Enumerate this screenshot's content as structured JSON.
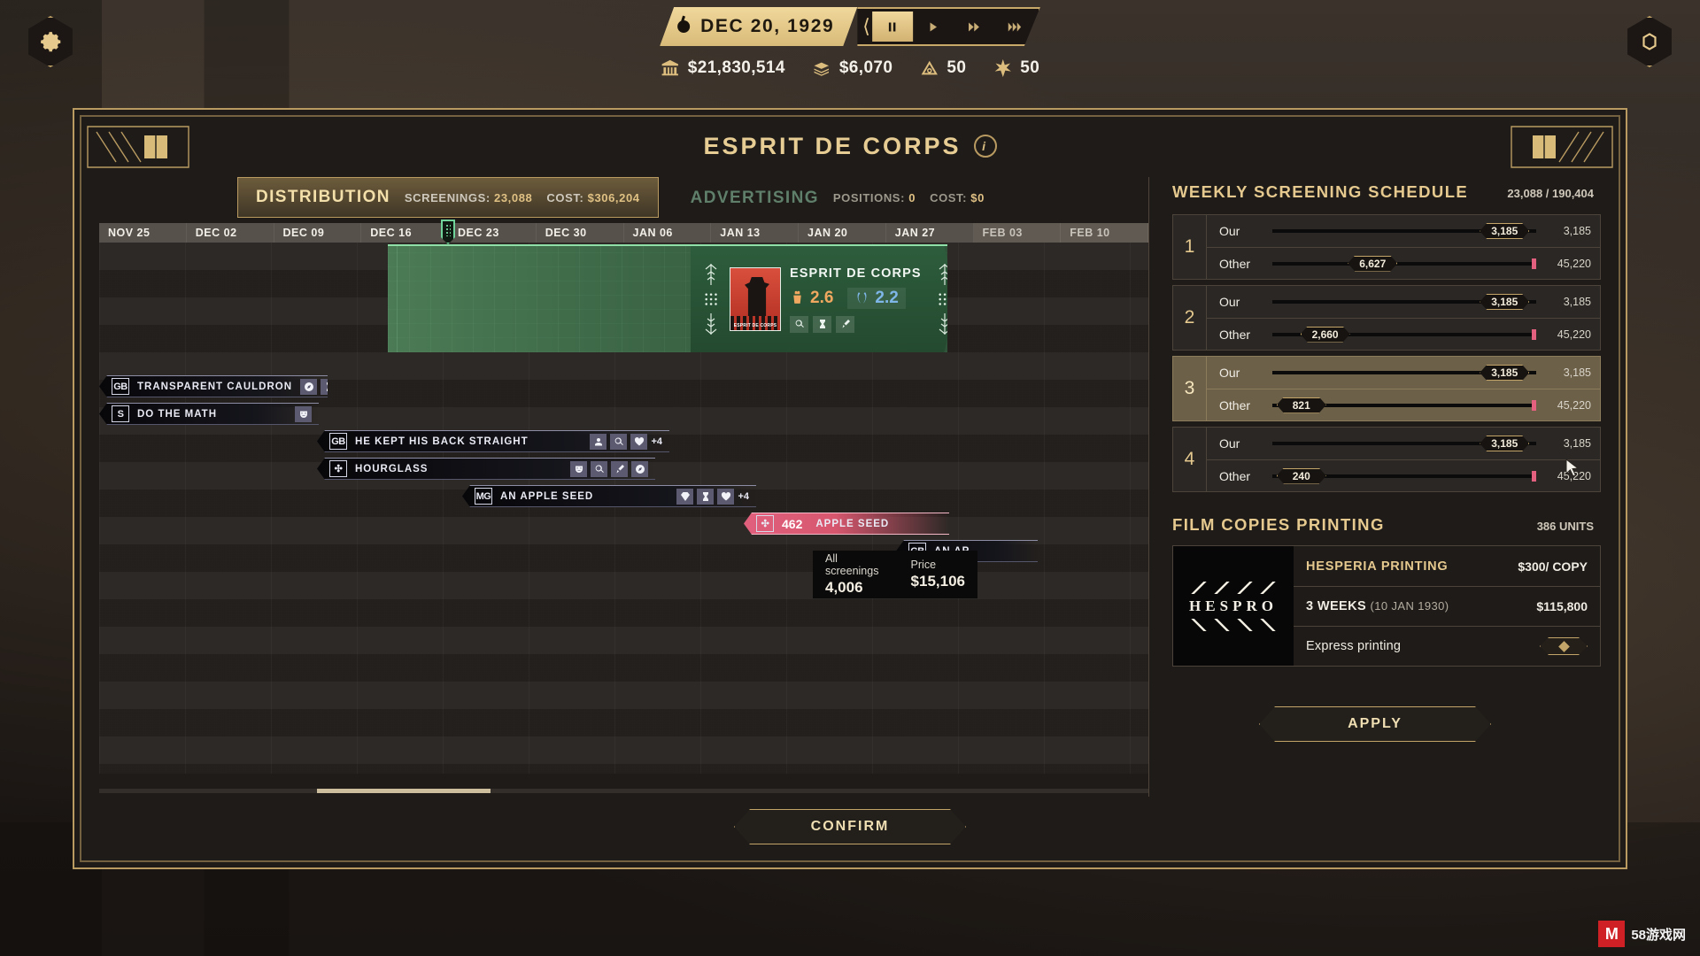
{
  "topbar": {
    "settings_icon": "gear-icon",
    "menu_icon": "hex-menu-icon",
    "date": "DEC 20, 1929",
    "speed_controls": [
      {
        "name": "pause",
        "glyph": "pause-icon",
        "active": true
      },
      {
        "name": "play",
        "glyph": "play-icon",
        "active": false
      },
      {
        "name": "fast-forward",
        "glyph": "fast-forward-icon",
        "active": false
      },
      {
        "name": "fastest",
        "glyph": "fastest-icon",
        "active": false
      }
    ],
    "resources": [
      {
        "icon": "bank-icon",
        "value": "$21,830,514"
      },
      {
        "icon": "money-stack-icon",
        "value": "$6,070"
      },
      {
        "icon": "eye-icon",
        "value": "50"
      },
      {
        "icon": "star-icon",
        "value": "50"
      }
    ]
  },
  "panel": {
    "title": "ESPRIT DE CORPS",
    "info_badge": "i",
    "confirm_label": "CONFIRM"
  },
  "tabs": {
    "distribution": {
      "label": "DISTRIBUTION",
      "screenings_label": "SCREENINGS:",
      "screenings_value": "23,088",
      "cost_label": "COST:",
      "cost_value": "$306,204"
    },
    "advertising": {
      "label": "ADVERTISING",
      "positions_label": "POSITIONS:",
      "positions_value": "0",
      "cost_label": "COST:",
      "cost_value": "$0"
    }
  },
  "timeline": {
    "columns": [
      "NOV 25",
      "DEC 02",
      "DEC 09",
      "DEC 16",
      "DEC 23",
      "DEC 30",
      "JAN 06",
      "JAN 13",
      "JAN 20",
      "JAN 27",
      "FEB 03",
      "FEB 10"
    ],
    "dim_columns": [
      "FEB 03",
      "FEB 10"
    ],
    "marker_at": "DEC 23",
    "release_card": {
      "title": "ESPRIT DE CORPS",
      "poster_title": "ESPRIT DE CORPS",
      "rating_audience": "2.6",
      "rating_critic": "2.2",
      "action_icons": [
        "magnify-icon",
        "hourglass-icon",
        "brush-icon"
      ]
    },
    "tooltip": {
      "screenings_label": "All screenings",
      "screenings_value": "4,006",
      "price_label": "Price",
      "price_value": "$15,106"
    },
    "movies": [
      {
        "studio": "GB",
        "title": "TRANSPARENT CAULDRON",
        "badges": [
          "compass-icon",
          "hourglass-icon"
        ],
        "extra": "",
        "style": "dark"
      },
      {
        "studio": "S",
        "title": "DO THE MATH",
        "badges": [
          "mask-icon"
        ],
        "extra": "",
        "style": "dark"
      },
      {
        "studio": "GB",
        "title": "HE KEPT HIS BACK STRAIGHT",
        "badges": [
          "person-icon",
          "magnify-icon",
          "heart-icon"
        ],
        "extra": "+4",
        "style": "dark"
      },
      {
        "studio": "✣",
        "title": "HOURGLASS",
        "badges": [
          "mask-icon",
          "magnify-icon",
          "brush-icon",
          "compass-icon"
        ],
        "extra": "",
        "style": "dark"
      },
      {
        "studio": "MG",
        "title": "AN APPLE SEED",
        "badges": [
          "gem-icon",
          "hourglass-icon",
          "heart-icon"
        ],
        "extra": "+4",
        "style": "dark"
      },
      {
        "studio": "✣",
        "title": "APPLE SEED",
        "count": "462",
        "badges": [],
        "extra": "",
        "style": "pink"
      },
      {
        "studio": "GB",
        "title": "AN AP",
        "badges": [],
        "extra": "",
        "style": "dark"
      }
    ]
  },
  "schedule": {
    "title": "WEEKLY SCREENING SCHEDULE",
    "meta": "23,088 / 190,404",
    "weeks": [
      {
        "num": "1",
        "rows": [
          {
            "label": "Our",
            "knob": "3,185",
            "cap": "3,185",
            "knob_pct": 88,
            "pink": false
          },
          {
            "label": "Other",
            "knob": "6,627",
            "cap": "45,220",
            "knob_pct": 38,
            "pink": true
          }
        ]
      },
      {
        "num": "2",
        "rows": [
          {
            "label": "Our",
            "knob": "3,185",
            "cap": "3,185",
            "knob_pct": 88,
            "pink": false
          },
          {
            "label": "Other",
            "knob": "2,660",
            "cap": "45,220",
            "knob_pct": 20,
            "pink": true
          }
        ]
      },
      {
        "num": "3",
        "highlight": true,
        "rows": [
          {
            "label": "Our",
            "knob": "3,185",
            "cap": "3,185",
            "knob_pct": 88,
            "pink": false
          },
          {
            "label": "Other",
            "knob": "821",
            "cap": "45,220",
            "knob_pct": 11,
            "pink": true
          }
        ]
      },
      {
        "num": "4",
        "rows": [
          {
            "label": "Our",
            "knob": "3,185",
            "cap": "3,185",
            "knob_pct": 88,
            "pink": false
          },
          {
            "label": "Other",
            "knob": "240",
            "cap": "45,220",
            "knob_pct": 11,
            "pink": true
          }
        ]
      }
    ]
  },
  "film_copies": {
    "title": "FILM COPIES PRINTING",
    "meta": "386 UNITS",
    "printer_logo": "HESPRO",
    "rows": [
      {
        "left": "HESPERIA PRINTING",
        "right": "$300/ COPY",
        "type": "head"
      },
      {
        "left": "3 WEEKS",
        "sub": "(10 JAN 1930)",
        "right": "$115,800",
        "type": "plain"
      },
      {
        "left": "Express printing",
        "right": "",
        "type": "express"
      }
    ],
    "apply_label": "APPLY"
  },
  "watermark": {
    "mark": "M",
    "text": "58游戏网"
  },
  "colors": {
    "gold": "#c8a96a",
    "gold_light": "#f0d79b",
    "green": "#3c6646",
    "pink": "#e4607f",
    "panel_bg": "#1e1b18"
  }
}
